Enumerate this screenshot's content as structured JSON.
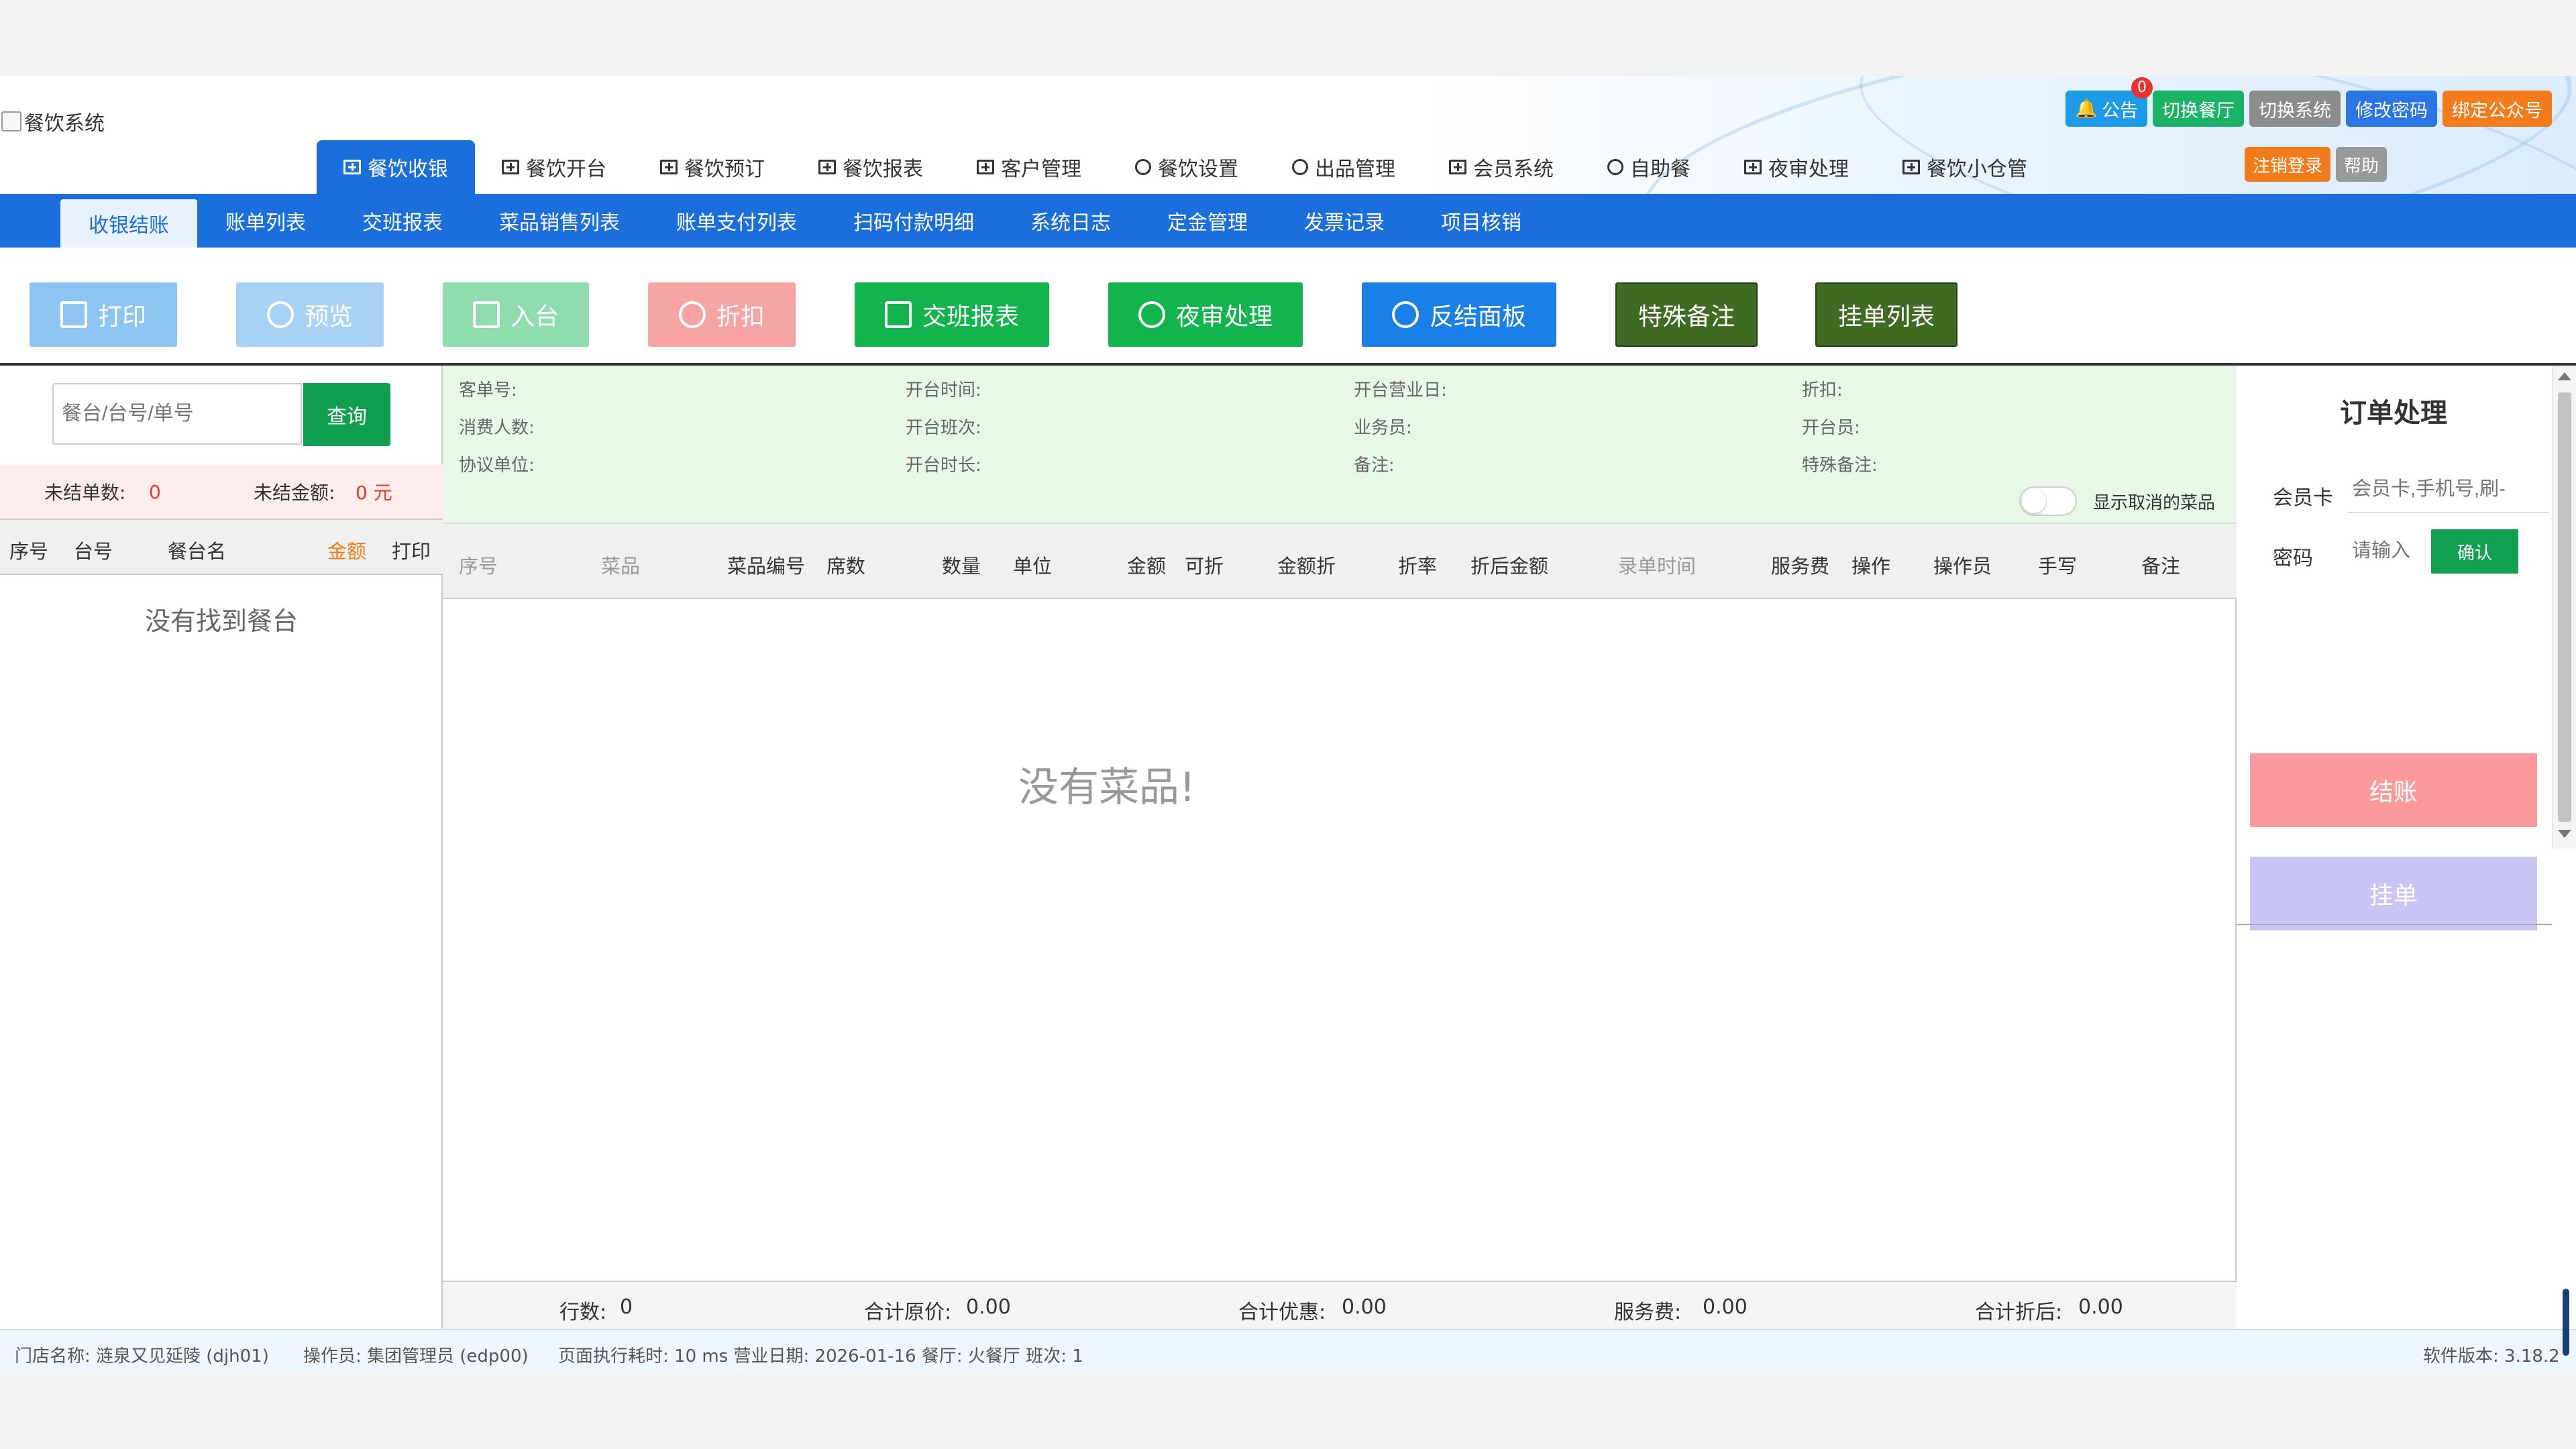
{
  "header": {
    "logo_alt": "餐饮系统",
    "top_buttons": [
      {
        "label": "公告",
        "badge": "0",
        "color": "blue"
      },
      {
        "label": "切换餐厅",
        "color": "green"
      },
      {
        "label": "切换系统",
        "color": "gray"
      },
      {
        "label": "修改密码",
        "color": "dblue"
      },
      {
        "label": "绑定公众号",
        "color": "orange"
      }
    ],
    "aux_buttons": [
      {
        "label": "注销登录",
        "color": "#f27c1c"
      },
      {
        "label": "帮助",
        "color": "#999999"
      }
    ],
    "nav": [
      {
        "label": "餐饮收银",
        "icon": "grid-icon",
        "active": true
      },
      {
        "label": "餐饮开台",
        "icon": "grid-icon"
      },
      {
        "label": "餐饮预订",
        "icon": "grid-icon"
      },
      {
        "label": "餐饮报表",
        "icon": "grid-icon"
      },
      {
        "label": "客户管理",
        "icon": "grid-icon"
      },
      {
        "label": "餐饮设置",
        "icon": "gear-icon"
      },
      {
        "label": "出品管理",
        "icon": "gear-icon"
      },
      {
        "label": "会员系统",
        "icon": "grid-icon"
      },
      {
        "label": "自助餐",
        "icon": "gear-icon"
      },
      {
        "label": "夜审处理",
        "icon": "grid-icon"
      },
      {
        "label": "餐饮小仓管",
        "icon": "grid-icon"
      }
    ]
  },
  "subnav": [
    "收银结账",
    "账单列表",
    "交班报表",
    "菜品销售列表",
    "账单支付列表",
    "扫码付款明细",
    "系统日志",
    "定金管理",
    "发票记录",
    "项目核销"
  ],
  "toolbar": [
    {
      "label": "打印",
      "icon": "printer-icon",
      "color": "#8cc4f2"
    },
    {
      "label": "预览",
      "icon": "eye-icon",
      "color": "#a8d2f4"
    },
    {
      "label": "入台",
      "icon": "cart-icon",
      "color": "#8fdcae"
    },
    {
      "label": "折扣",
      "icon": "percent-icon",
      "color": "#f5a3a3"
    },
    {
      "label": "交班报表",
      "icon": "document-icon",
      "color": "#12b44e"
    },
    {
      "label": "夜审处理",
      "icon": "eye-icon",
      "color": "#12b44e"
    },
    {
      "label": "反结面板",
      "icon": "yen-icon",
      "color": "#1a7fe6"
    },
    {
      "label": "特殊备注",
      "icon": "",
      "color": "#3f6b22"
    },
    {
      "label": "挂单列表",
      "icon": "",
      "color": "#3f6b22"
    }
  ],
  "left": {
    "search_placeholder": "餐台/台号/单号",
    "search_button": "查询",
    "unsettled_count_label": "未结单数:",
    "unsettled_count": "0",
    "unsettled_amount_label": "未结金额:",
    "unsettled_amount": "0 元",
    "columns": [
      "序号",
      "台号",
      "餐台名",
      "金额",
      "打印"
    ],
    "empty_text": "没有找到餐台"
  },
  "center": {
    "info_fields": [
      [
        "客单号:",
        "开台时间:",
        "开台营业日:",
        "折扣:"
      ],
      [
        "消费人数:",
        "开台班次:",
        "业务员:",
        "开台员:"
      ],
      [
        "协议单位:",
        "开台时长:",
        "备注:",
        "特殊备注:"
      ]
    ],
    "show_cancelled_label": "显示取消的菜品",
    "columns": [
      "序号",
      "菜品",
      "菜品编号",
      "席数",
      "数量",
      "单位",
      "金额",
      "可折",
      "金额折",
      "折率",
      "折后金额",
      "录单时间",
      "服务费",
      "操作",
      "操作员",
      "手写",
      "备注"
    ],
    "empty_text": "没有菜品!",
    "totals": {
      "rows_label": "行数:",
      "rows": "0",
      "orig_label": "合计原价:",
      "orig": "0.00",
      "discount_label": "合计优惠:",
      "discount": "0.00",
      "service_label": "服务费:",
      "service": "0.00",
      "after_label": "合计折后:",
      "after": "0.00"
    }
  },
  "right": {
    "title": "订单处理",
    "member_label": "会员卡",
    "member_placeholder": "会员卡,手机号,刷-",
    "password_label": "密码",
    "password_placeholder": "请输入",
    "confirm_label": "确认",
    "settle_label": "结账",
    "hold_label": "挂单"
  },
  "status": {
    "store": "门店名称: 涟泉又见延陵 (djh01)",
    "operator": "操作员: 集团管理员 (edp00)",
    "exec": "页面执行耗时: 10 ms 营业日期: 2026-01-16 餐厅: 火餐厅 班次: 1",
    "version": "软件版本: 3.18.2"
  }
}
